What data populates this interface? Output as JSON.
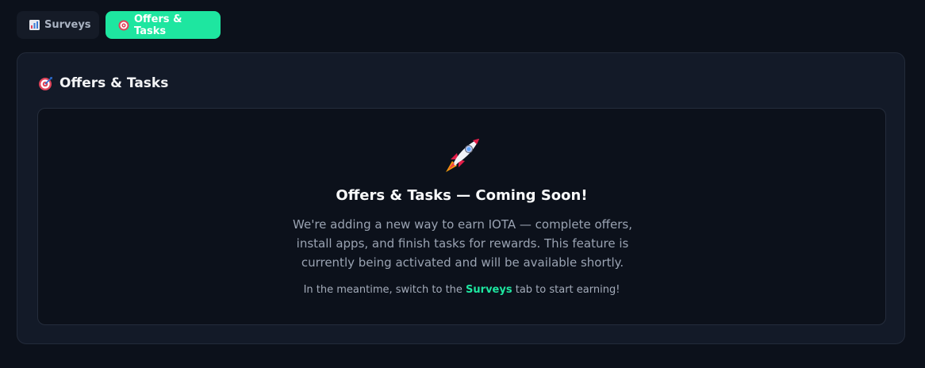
{
  "tabs": [
    {
      "label": "Surveys",
      "icon": "bar-chart-icon",
      "active": false
    },
    {
      "label": "Offers & Tasks",
      "icon": "target-icon",
      "active": true
    }
  ],
  "panel": {
    "title": "Offers & Tasks",
    "icon": "target-icon"
  },
  "coming_soon": {
    "icon": "rocket-icon",
    "heading": "Offers & Tasks — Coming Soon!",
    "description": "We're adding a new way to earn IOTA — complete offers, install apps, and finish tasks for rewards. This feature is currently being activated and will be available shortly.",
    "note_prefix": "In the meantime, switch to the",
    "note_link": "Surveys",
    "note_suffix": "tab to start earning!"
  },
  "colors": {
    "accent": "#1ee6a0",
    "background": "#0c111b",
    "panel": "#131a28"
  }
}
